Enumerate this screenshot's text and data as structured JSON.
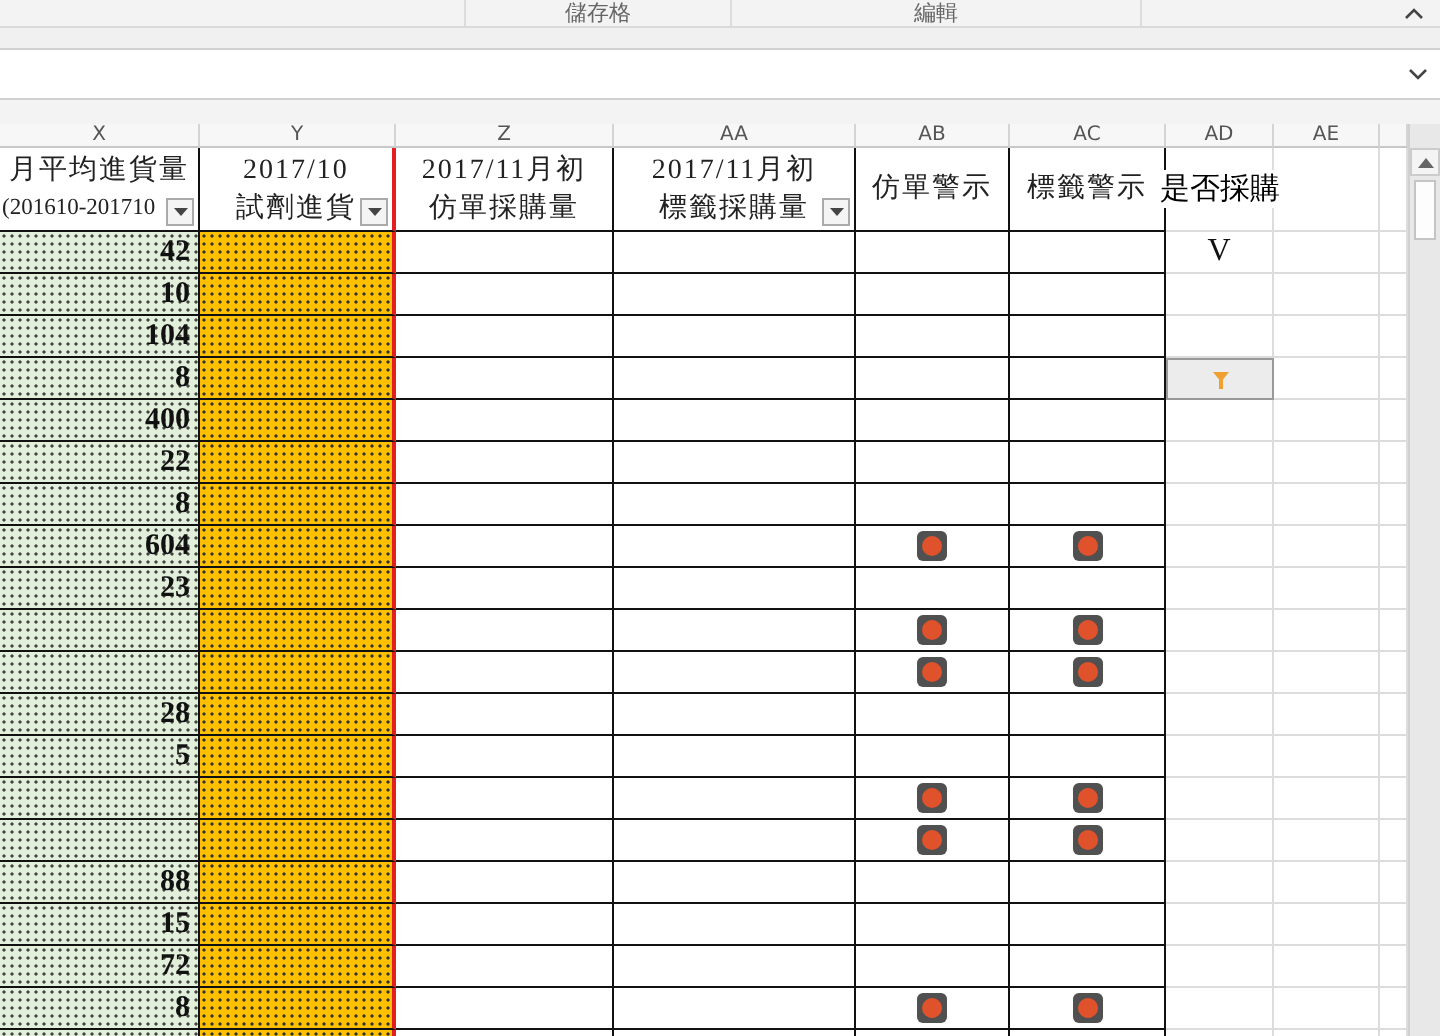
{
  "ribbon_groups": [
    "儲存格",
    "編輯"
  ],
  "columns": [
    {
      "letter": "X",
      "header_lines": [
        "月平均進貨量",
        "(201610-201710"
      ],
      "filter": true
    },
    {
      "letter": "Y",
      "header_lines": [
        "2017/10",
        "試劑進貨"
      ],
      "filter": true
    },
    {
      "letter": "Z",
      "header_lines": [
        "2017/11月初",
        "仿單採購量"
      ],
      "filter": false
    },
    {
      "letter": "AA",
      "header_lines": [
        "2017/11月初",
        "標籤採購量"
      ],
      "filter": true
    },
    {
      "letter": "AB",
      "header_lines": [
        "仿單警示"
      ],
      "filter": false
    },
    {
      "letter": "AC",
      "header_lines": [
        "標籤警示"
      ],
      "filter": false
    },
    {
      "letter": "AD",
      "header_lines": [
        "是否採購"
      ],
      "filter": false
    },
    {
      "letter": "AE",
      "filter": false
    }
  ],
  "rows": [
    {
      "avg": "42",
      "insert_warning": false,
      "label_warning": false,
      "purchase": "V",
      "selected": false
    },
    {
      "avg": "10",
      "insert_warning": false,
      "label_warning": false,
      "selected": false
    },
    {
      "avg": "104",
      "insert_warning": false,
      "label_warning": false,
      "selected": false
    },
    {
      "avg": "8",
      "insert_warning": false,
      "label_warning": false,
      "selected": true
    },
    {
      "avg": "400",
      "insert_warning": false,
      "label_warning": false,
      "selected": false
    },
    {
      "avg": "22",
      "insert_warning": false,
      "label_warning": false,
      "selected": false
    },
    {
      "avg": "8",
      "insert_warning": false,
      "label_warning": false,
      "selected": false
    },
    {
      "avg": "604",
      "insert_warning": true,
      "label_warning": true,
      "selected": false
    },
    {
      "avg": "23",
      "insert_warning": false,
      "label_warning": false,
      "selected": false
    },
    {
      "insert_warning": true,
      "label_warning": true,
      "selected": false
    },
    {
      "insert_warning": true,
      "label_warning": true,
      "selected": false
    },
    {
      "avg": "28",
      "insert_warning": false,
      "label_warning": false,
      "selected": false
    },
    {
      "avg": "5",
      "insert_warning": false,
      "label_warning": false,
      "selected": false
    },
    {
      "insert_warning": true,
      "label_warning": true,
      "selected": false
    },
    {
      "insert_warning": true,
      "label_warning": true,
      "selected": false
    },
    {
      "avg": "88",
      "insert_warning": false,
      "label_warning": false,
      "selected": false
    },
    {
      "avg": "15",
      "insert_warning": false,
      "label_warning": false,
      "selected": false
    },
    {
      "avg": "72",
      "insert_warning": false,
      "label_warning": false,
      "selected": false
    },
    {
      "avg": "8",
      "insert_warning": true,
      "label_warning": true,
      "selected": false
    },
    {
      "insert_warning": false,
      "label_warning": false,
      "selected": false
    }
  ]
}
